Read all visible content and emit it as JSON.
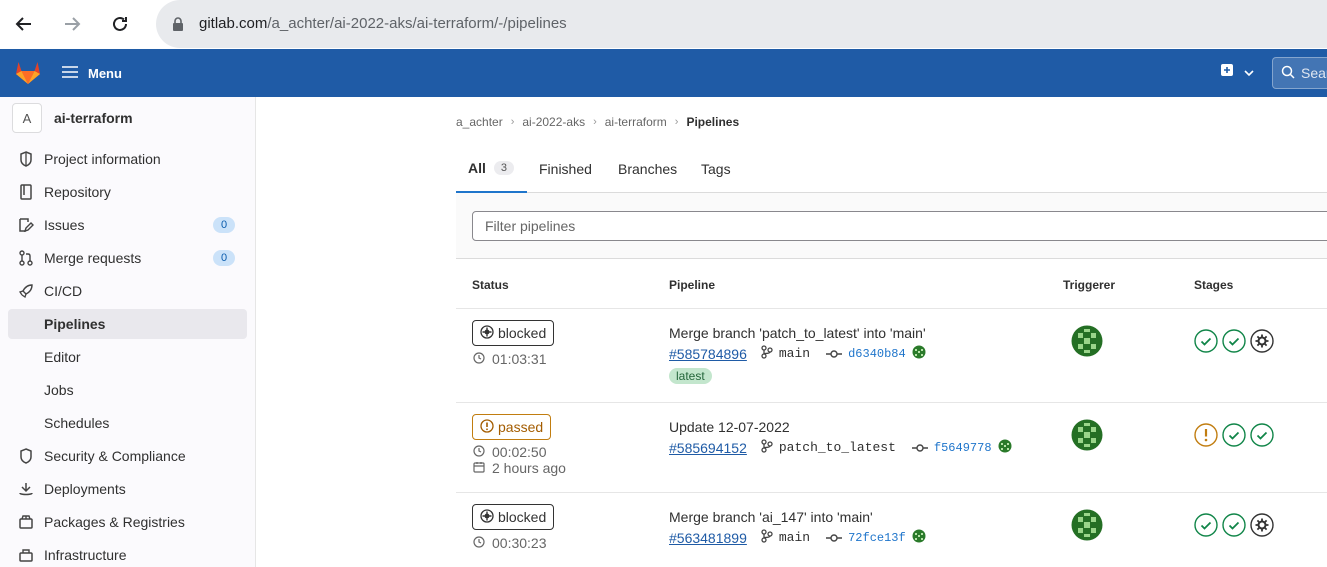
{
  "browser": {
    "url_host": "gitlab.com",
    "url_path": "/a_achter/ai-2022-aks/ai-terraform/-/pipelines"
  },
  "header": {
    "menu_label": "Menu",
    "search_placeholder": "Search"
  },
  "sidebar": {
    "project_initial": "A",
    "project_name": "ai-terraform",
    "items": [
      {
        "label": "Project information",
        "icon": "project-info-icon"
      },
      {
        "label": "Repository",
        "icon": "repository-icon"
      },
      {
        "label": "Issues",
        "icon": "issues-icon",
        "count": "0"
      },
      {
        "label": "Merge requests",
        "icon": "merge-request-icon",
        "count": "0"
      },
      {
        "label": "CI/CD",
        "icon": "rocket-icon"
      },
      {
        "label": "Pipelines",
        "active": true
      },
      {
        "label": "Editor"
      },
      {
        "label": "Jobs"
      },
      {
        "label": "Schedules"
      },
      {
        "label": "Security & Compliance",
        "icon": "shield-icon"
      },
      {
        "label": "Deployments",
        "icon": "deployments-icon"
      },
      {
        "label": "Packages & Registries",
        "icon": "package-icon"
      },
      {
        "label": "Infrastructure",
        "icon": "infrastructure-icon"
      }
    ]
  },
  "breadcrumb": [
    "a_achter",
    "ai-2022-aks",
    "ai-terraform",
    "Pipelines"
  ],
  "tabs": [
    {
      "label": "All",
      "count": "3"
    },
    {
      "label": "Finished"
    },
    {
      "label": "Branches"
    },
    {
      "label": "Tags"
    }
  ],
  "filter": {
    "placeholder": "Filter pipelines"
  },
  "table": {
    "headers": {
      "status": "Status",
      "pipeline": "Pipeline",
      "triggerer": "Triggerer",
      "stages": "Stages"
    },
    "rows": [
      {
        "status": "blocked",
        "duration": "01:03:31",
        "title": "Merge branch 'patch_to_latest' into 'main'",
        "id": "#585784896",
        "branch": "main",
        "sha": "d6340b84",
        "tag": "latest",
        "stages": [
          "success",
          "success",
          "manual"
        ]
      },
      {
        "status": "passed",
        "duration": "00:02:50",
        "finished": "2 hours ago",
        "title": "Update 12-07-2022",
        "id": "#585694152",
        "branch": "patch_to_latest",
        "sha": "f5649778",
        "stages": [
          "warning",
          "success",
          "success"
        ]
      },
      {
        "status": "blocked",
        "duration": "00:30:23",
        "title": "Merge branch 'ai_147' into 'main'",
        "id": "#563481899",
        "branch": "main",
        "sha": "72fce13f",
        "stages": [
          "success",
          "success",
          "manual"
        ]
      }
    ]
  },
  "colors": {
    "header_bg": "#1f5ba6",
    "success": "#108548",
    "warning": "#c17d10",
    "link": "#1f5ba6"
  }
}
